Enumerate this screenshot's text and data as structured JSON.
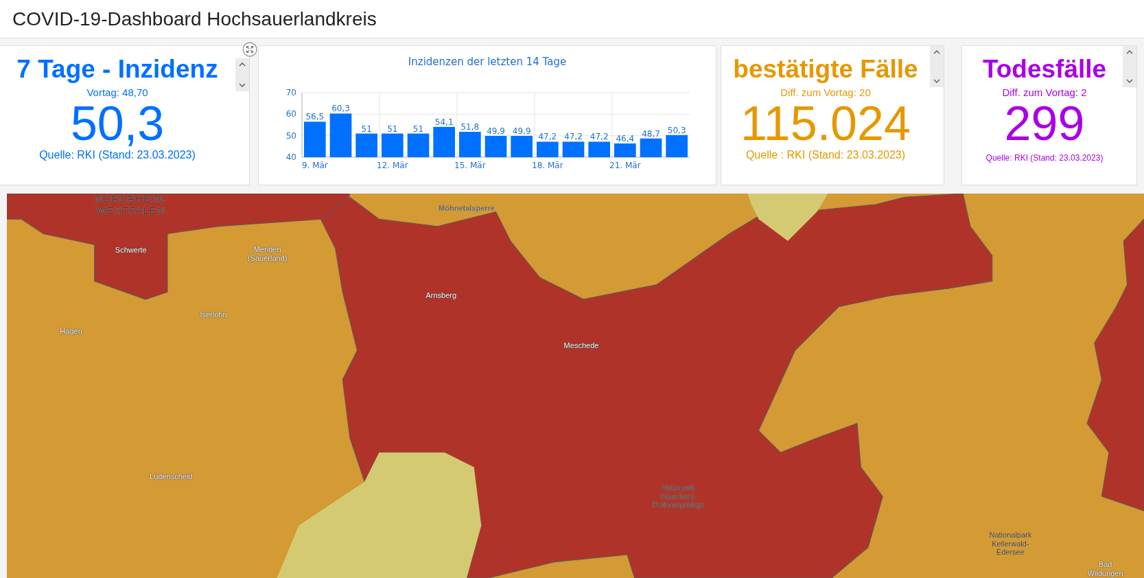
{
  "header": {
    "title": "COVID-19-Dashboard Hochsauerlandkreis"
  },
  "cards": [
    {
      "kind": "indicator",
      "color": "#0070ff",
      "title": "7 Tage - Inzidenz",
      "subtitle": "Vortag: 48,70",
      "value": "50,3",
      "footer": "Quelle: RKI (Stand: 23.03.2023)",
      "expand": true
    },
    {
      "kind": "chart",
      "title": "Inzidenzen der letzten 14 Tage",
      "chart_data": {
        "type": "bar",
        "values": [
          56.5,
          60.3,
          51,
          51,
          51,
          54.1,
          51.8,
          49.9,
          49.9,
          47.2,
          47.2,
          47.2,
          46.4,
          48.7,
          50.3
        ],
        "value_labels": [
          "56,5",
          "60,3",
          "51",
          "51",
          "51",
          "54,1",
          "51,8",
          "49,9",
          "49,9",
          "47,2",
          "47,2",
          "47,2",
          "46,4",
          "48,7",
          "50,3"
        ],
        "ylim": [
          40,
          70
        ],
        "yticks": [
          40,
          50,
          60,
          70
        ],
        "xlim": [
          8.5,
          23.5
        ],
        "x": [
          9,
          10,
          11,
          12,
          13,
          14,
          15,
          16,
          17,
          18,
          19,
          20,
          21,
          22,
          23
        ],
        "xticks": [
          {
            "value": 9,
            "label": "9. Mär"
          },
          {
            "value": 12,
            "label": "12. Mär"
          },
          {
            "value": 15,
            "label": "15. Mär"
          },
          {
            "value": 18,
            "label": "18. Mär"
          },
          {
            "value": 21,
            "label": "21. Mär"
          }
        ],
        "color": "#0070ff"
      }
    },
    {
      "kind": "indicator",
      "color": "#e69800",
      "title": "bestätigte Fälle",
      "subtitle": "Diff. zum Vortag: 20",
      "value": "115.024",
      "footer": "Quelle : RKI (Stand: 23.03.2023)",
      "expand": false
    },
    {
      "kind": "indicator",
      "color": "#a900e6",
      "title": "Todesfälle",
      "subtitle": "Diff. zum Vortag: 2",
      "value": "299",
      "footer": "Quelle: RKI (Stand: 23.03.2023)",
      "expand": false,
      "small_footer": true
    }
  ],
  "map": {
    "labels": [
      {
        "kind": "state",
        "text": "NORDRHEIN-WESTFALEN"
      },
      {
        "kind": "water",
        "text": "Möhnetalsperre"
      },
      {
        "kind": "city",
        "text": "Schwerte"
      },
      {
        "kind": "city",
        "text": "Menden (Sauerland)"
      },
      {
        "kind": "city",
        "text": "Iserlohn"
      },
      {
        "kind": "city",
        "text": "Hagen"
      },
      {
        "kind": "city",
        "text": "Arnsberg"
      },
      {
        "kind": "city",
        "text": "Meschede"
      },
      {
        "kind": "city",
        "text": "Lüdenscheid"
      },
      {
        "kind": "park",
        "text": "Naturpark Sauerland-Rothaargebirge"
      },
      {
        "kind": "park",
        "text": "Nationalpark Kellerwald-Edersee"
      },
      {
        "kind": "city",
        "text": "Bad Wildungen"
      }
    ]
  }
}
